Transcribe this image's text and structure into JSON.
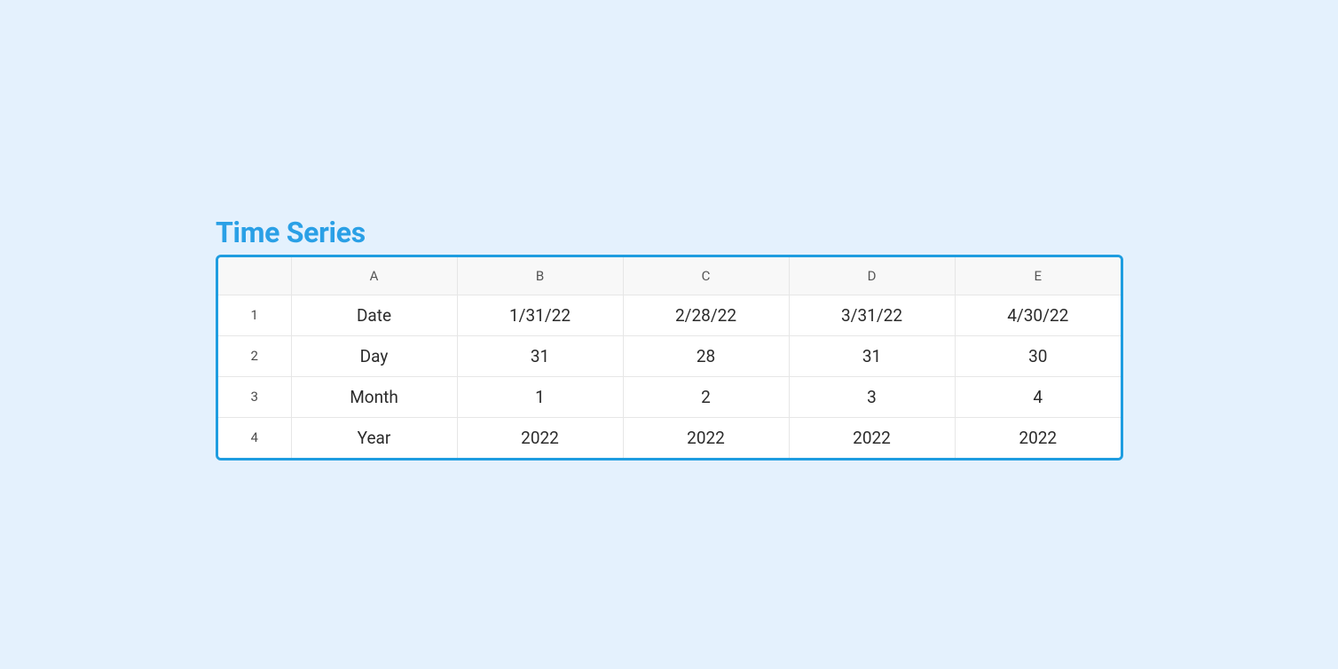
{
  "title": "Time Series",
  "chart_data": {
    "type": "table",
    "columns": [
      "A",
      "B",
      "C",
      "D",
      "E"
    ],
    "rows": [
      {
        "num": "1",
        "cells": [
          "Date",
          "1/31/22",
          "2/28/22",
          "3/31/22",
          "4/30/22"
        ]
      },
      {
        "num": "2",
        "cells": [
          "Day",
          "31",
          "28",
          "31",
          "30"
        ]
      },
      {
        "num": "3",
        "cells": [
          "Month",
          "1",
          "2",
          "3",
          "4"
        ]
      },
      {
        "num": "4",
        "cells": [
          "Year",
          "2022",
          "2022",
          "2022",
          "2022"
        ]
      }
    ]
  }
}
